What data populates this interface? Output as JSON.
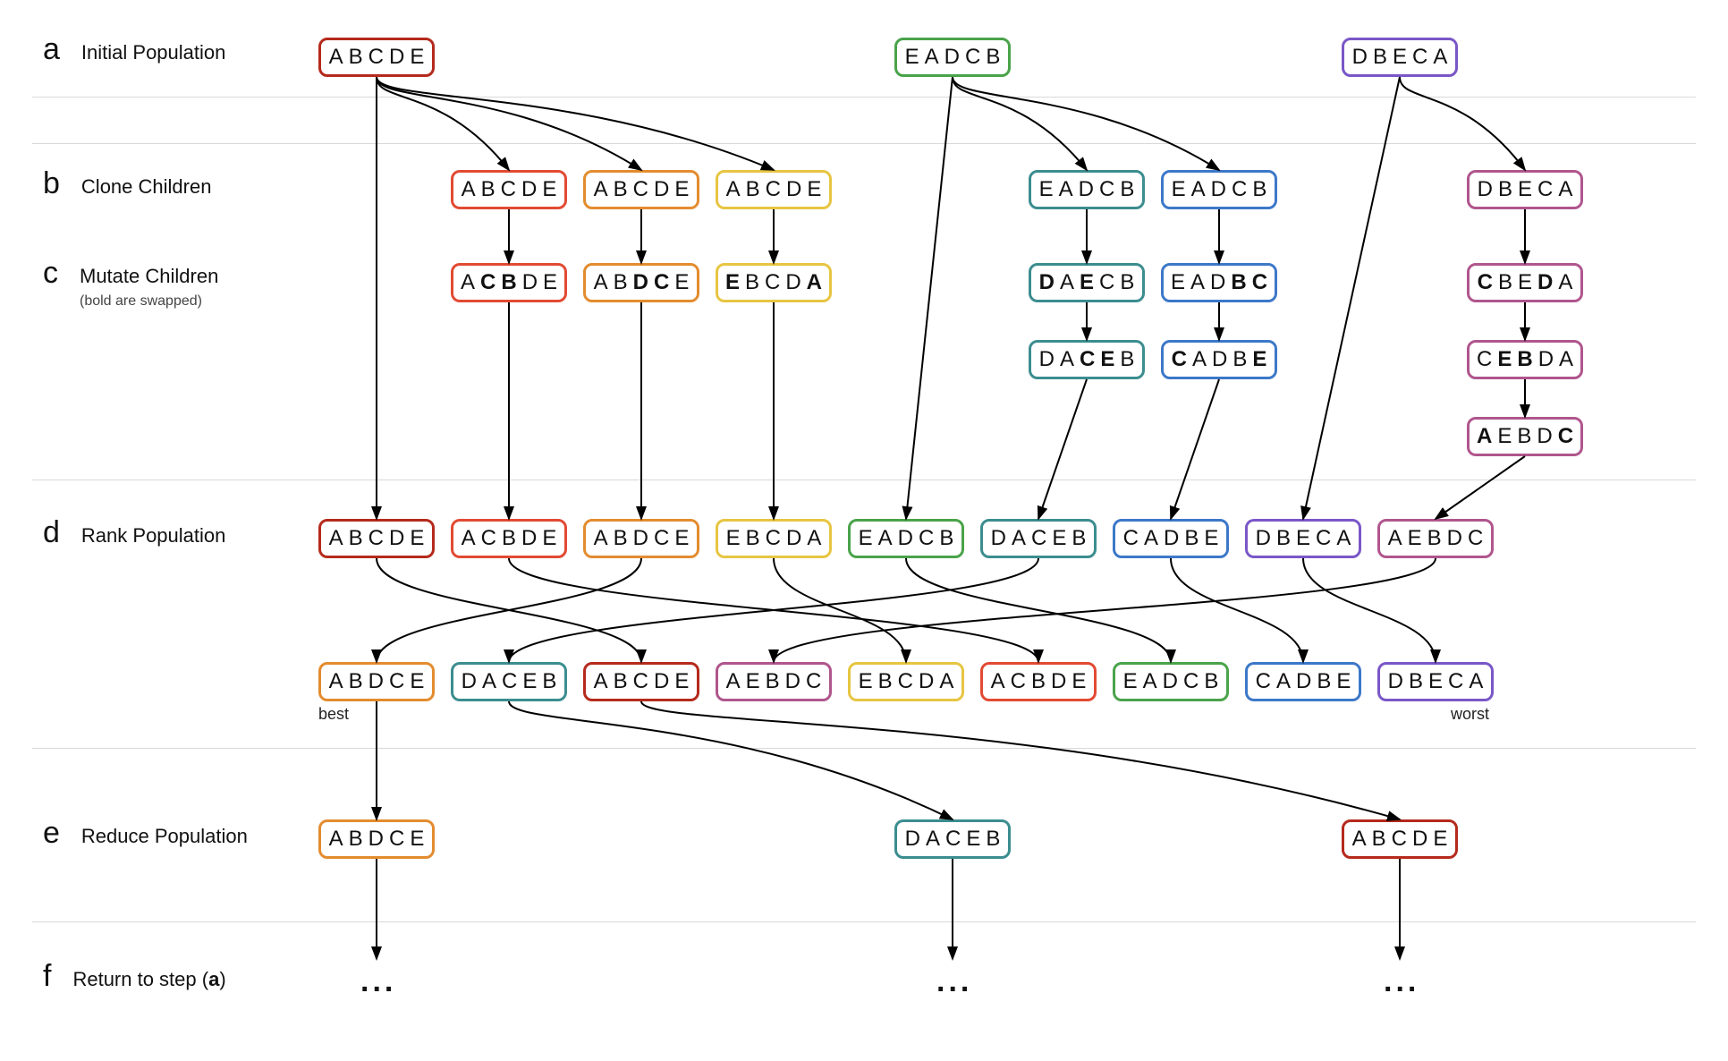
{
  "colors": {
    "darkred": "#b52a1c",
    "red": "#e24a33",
    "orange": "#e38c2f",
    "yellow": "#e7c542",
    "green": "#4aa34a",
    "teal": "#3c8d8f",
    "blue": "#3c78c8",
    "purple": "#7a57c7",
    "plum": "#b0568d"
  },
  "steps": {
    "a": {
      "letter": "a",
      "title": "Initial Population"
    },
    "b": {
      "letter": "b",
      "title": "Clone Children"
    },
    "c": {
      "letter": "c",
      "title": "Mutate Children",
      "sub": "(bold are swapped)"
    },
    "d": {
      "letter": "d",
      "title": "Rank Population"
    },
    "e": {
      "letter": "e",
      "title": "Reduce Population"
    },
    "f": {
      "letter": "f",
      "title": "Return to step (a)"
    }
  },
  "labels": {
    "best": "best",
    "worst": "worst",
    "dots": "..."
  },
  "nodes": {
    "a1": {
      "seq": [
        "A",
        "B",
        "C",
        "D",
        "E"
      ],
      "bold": [],
      "color": "darkred"
    },
    "a2": {
      "seq": [
        "E",
        "A",
        "D",
        "C",
        "B"
      ],
      "bold": [],
      "color": "green"
    },
    "a3": {
      "seq": [
        "D",
        "B",
        "E",
        "C",
        "A"
      ],
      "bold": [],
      "color": "purple"
    },
    "b1": {
      "seq": [
        "A",
        "B",
        "C",
        "D",
        "E"
      ],
      "bold": [],
      "color": "red"
    },
    "b2": {
      "seq": [
        "A",
        "B",
        "C",
        "D",
        "E"
      ],
      "bold": [],
      "color": "orange"
    },
    "b3": {
      "seq": [
        "A",
        "B",
        "C",
        "D",
        "E"
      ],
      "bold": [],
      "color": "yellow"
    },
    "b4": {
      "seq": [
        "E",
        "A",
        "D",
        "C",
        "B"
      ],
      "bold": [],
      "color": "teal"
    },
    "b5": {
      "seq": [
        "E",
        "A",
        "D",
        "C",
        "B"
      ],
      "bold": [],
      "color": "blue"
    },
    "b6": {
      "seq": [
        "D",
        "B",
        "E",
        "C",
        "A"
      ],
      "bold": [],
      "color": "plum"
    },
    "c1": {
      "seq": [
        "A",
        "C",
        "B",
        "D",
        "E"
      ],
      "bold": [
        1,
        2
      ],
      "color": "red"
    },
    "c2": {
      "seq": [
        "A",
        "B",
        "D",
        "C",
        "E"
      ],
      "bold": [
        2,
        3
      ],
      "color": "orange"
    },
    "c3": {
      "seq": [
        "E",
        "B",
        "C",
        "D",
        "A"
      ],
      "bold": [
        0,
        4
      ],
      "color": "yellow"
    },
    "c4": {
      "seq": [
        "D",
        "A",
        "E",
        "C",
        "B"
      ],
      "bold": [
        0,
        2
      ],
      "color": "teal"
    },
    "c5": {
      "seq": [
        "E",
        "A",
        "D",
        "B",
        "C"
      ],
      "bold": [
        3,
        4
      ],
      "color": "blue"
    },
    "c6": {
      "seq": [
        "C",
        "B",
        "E",
        "D",
        "A"
      ],
      "bold": [
        0,
        3
      ],
      "color": "plum"
    },
    "c4b": {
      "seq": [
        "D",
        "A",
        "C",
        "E",
        "B"
      ],
      "bold": [
        2,
        3
      ],
      "color": "teal"
    },
    "c5b": {
      "seq": [
        "C",
        "A",
        "D",
        "B",
        "E"
      ],
      "bold": [
        0,
        4
      ],
      "color": "blue"
    },
    "c6b": {
      "seq": [
        "C",
        "E",
        "B",
        "D",
        "A"
      ],
      "bold": [
        1,
        2
      ],
      "color": "plum"
    },
    "c6c": {
      "seq": [
        "A",
        "E",
        "B",
        "D",
        "C"
      ],
      "bold": [
        0,
        4
      ],
      "color": "plum"
    },
    "d1": {
      "seq": [
        "A",
        "B",
        "C",
        "D",
        "E"
      ],
      "bold": [],
      "color": "darkred"
    },
    "d2": {
      "seq": [
        "A",
        "C",
        "B",
        "D",
        "E"
      ],
      "bold": [],
      "color": "red"
    },
    "d3": {
      "seq": [
        "A",
        "B",
        "D",
        "C",
        "E"
      ],
      "bold": [],
      "color": "orange"
    },
    "d4": {
      "seq": [
        "E",
        "B",
        "C",
        "D",
        "A"
      ],
      "bold": [],
      "color": "yellow"
    },
    "d5": {
      "seq": [
        "E",
        "A",
        "D",
        "C",
        "B"
      ],
      "bold": [],
      "color": "green"
    },
    "d6": {
      "seq": [
        "D",
        "A",
        "C",
        "E",
        "B"
      ],
      "bold": [],
      "color": "teal"
    },
    "d7": {
      "seq": [
        "C",
        "A",
        "D",
        "B",
        "E"
      ],
      "bold": [],
      "color": "blue"
    },
    "d8": {
      "seq": [
        "D",
        "B",
        "E",
        "C",
        "A"
      ],
      "bold": [],
      "color": "purple"
    },
    "d9": {
      "seq": [
        "A",
        "E",
        "B",
        "D",
        "C"
      ],
      "bold": [],
      "color": "plum"
    },
    "r1": {
      "seq": [
        "A",
        "B",
        "D",
        "C",
        "E"
      ],
      "bold": [],
      "color": "orange"
    },
    "r2": {
      "seq": [
        "D",
        "A",
        "C",
        "E",
        "B"
      ],
      "bold": [],
      "color": "teal"
    },
    "r3": {
      "seq": [
        "A",
        "B",
        "C",
        "D",
        "E"
      ],
      "bold": [],
      "color": "darkred"
    },
    "r4": {
      "seq": [
        "A",
        "E",
        "B",
        "D",
        "C"
      ],
      "bold": [],
      "color": "plum"
    },
    "r5": {
      "seq": [
        "E",
        "B",
        "C",
        "D",
        "A"
      ],
      "bold": [],
      "color": "yellow"
    },
    "r6": {
      "seq": [
        "A",
        "C",
        "B",
        "D",
        "E"
      ],
      "bold": [],
      "color": "red"
    },
    "r7": {
      "seq": [
        "E",
        "A",
        "D",
        "C",
        "B"
      ],
      "bold": [],
      "color": "green"
    },
    "r8": {
      "seq": [
        "C",
        "A",
        "D",
        "B",
        "E"
      ],
      "bold": [],
      "color": "blue"
    },
    "r9": {
      "seq": [
        "D",
        "B",
        "E",
        "C",
        "A"
      ],
      "bold": [],
      "color": "purple"
    },
    "e1": {
      "seq": [
        "A",
        "B",
        "D",
        "C",
        "E"
      ],
      "bold": [],
      "color": "orange"
    },
    "e2": {
      "seq": [
        "D",
        "A",
        "C",
        "E",
        "B"
      ],
      "bold": [],
      "color": "teal"
    },
    "e3": {
      "seq": [
        "A",
        "B",
        "C",
        "D",
        "E"
      ],
      "bold": [],
      "color": "darkred"
    }
  },
  "layout": {
    "nodeW": 130,
    "rows": {
      "a": 42,
      "b": 190,
      "c": 294,
      "c2": 380,
      "c3": 466,
      "d": 580,
      "r": 740,
      "e": 916,
      "f": 1078
    },
    "xcols": [
      356,
      504,
      652,
      800,
      948,
      1096,
      1244,
      1392,
      1540
    ],
    "x_a": [
      356,
      1000,
      1500
    ],
    "x_b": [
      504,
      652,
      800,
      1150,
      1298,
      1640
    ],
    "x_e": [
      356,
      1000,
      1500
    ],
    "hr": [
      108,
      160,
      536,
      836,
      1030
    ]
  },
  "arrows": [
    [
      "a1",
      "b1",
      "curve"
    ],
    [
      "a1",
      "b2",
      "curve"
    ],
    [
      "a1",
      "b3",
      "curve"
    ],
    [
      "a2",
      "b4",
      "curve"
    ],
    [
      "a2",
      "b5",
      "curve"
    ],
    [
      "a3",
      "b6",
      "curve"
    ],
    [
      "a1",
      "d1",
      "down"
    ],
    [
      "a2",
      "d5",
      "down"
    ],
    [
      "a3",
      "d8",
      "down"
    ],
    [
      "b1",
      "c1",
      "down"
    ],
    [
      "b2",
      "c2",
      "down"
    ],
    [
      "b3",
      "c3",
      "down"
    ],
    [
      "b4",
      "c4",
      "down"
    ],
    [
      "b5",
      "c5",
      "down"
    ],
    [
      "b6",
      "c6",
      "down"
    ],
    [
      "c4",
      "c4b",
      "down"
    ],
    [
      "c5",
      "c5b",
      "down"
    ],
    [
      "c6",
      "c6b",
      "down"
    ],
    [
      "c6b",
      "c6c",
      "down"
    ],
    [
      "c1",
      "d2",
      "down"
    ],
    [
      "c2",
      "d3",
      "down"
    ],
    [
      "c3",
      "d4",
      "down"
    ],
    [
      "c4b",
      "d6",
      "down"
    ],
    [
      "c5b",
      "d7",
      "down"
    ],
    [
      "c6c",
      "d9",
      "down"
    ],
    [
      "d1",
      "r3",
      "rank"
    ],
    [
      "d2",
      "r6",
      "rank"
    ],
    [
      "d3",
      "r1",
      "rank"
    ],
    [
      "d4",
      "r5",
      "rank"
    ],
    [
      "d5",
      "r7",
      "rank"
    ],
    [
      "d6",
      "r2",
      "rank"
    ],
    [
      "d7",
      "r8",
      "rank"
    ],
    [
      "d8",
      "r9",
      "rank"
    ],
    [
      "d9",
      "r4",
      "rank"
    ],
    [
      "r1",
      "e1",
      "down"
    ],
    [
      "r2",
      "e2",
      "curve"
    ],
    [
      "r3",
      "e3",
      "curve"
    ]
  ]
}
